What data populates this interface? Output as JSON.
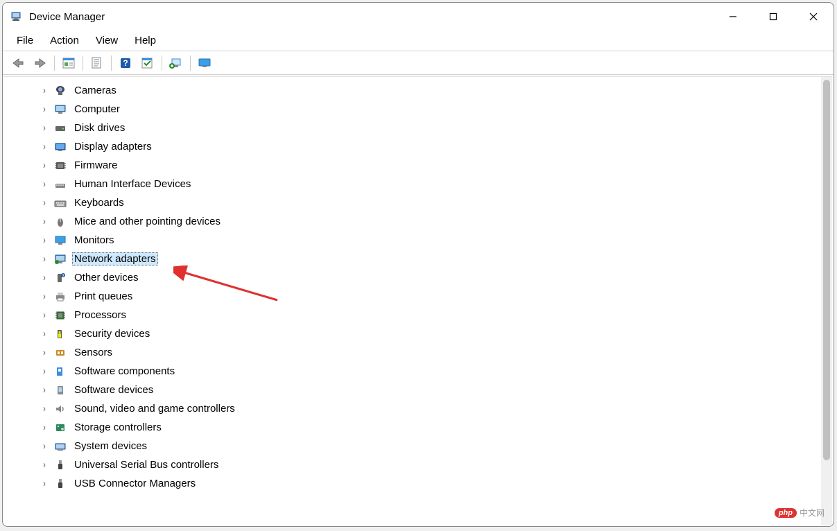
{
  "window": {
    "title": "Device Manager"
  },
  "menu": {
    "file": "File",
    "action": "Action",
    "view": "View",
    "help": "Help"
  },
  "toolbar_icons": {
    "back": "back-arrow",
    "forward": "forward-arrow",
    "show_hide": "show-hide-console-tree",
    "properties": "properties",
    "help": "help",
    "scan": "scan-hardware",
    "add_legacy": "add-legacy-hardware",
    "monitor": "remote-view"
  },
  "tree": {
    "items": [
      {
        "label": "Cameras",
        "icon": "camera-icon"
      },
      {
        "label": "Computer",
        "icon": "computer-icon"
      },
      {
        "label": "Disk drives",
        "icon": "disk-icon"
      },
      {
        "label": "Display adapters",
        "icon": "display-adapter-icon"
      },
      {
        "label": "Firmware",
        "icon": "firmware-icon"
      },
      {
        "label": "Human Interface Devices",
        "icon": "hid-icon"
      },
      {
        "label": "Keyboards",
        "icon": "keyboard-icon"
      },
      {
        "label": "Mice and other pointing devices",
        "icon": "mouse-icon"
      },
      {
        "label": "Monitors",
        "icon": "monitor-icon"
      },
      {
        "label": "Network adapters",
        "icon": "network-adapter-icon",
        "selected": true
      },
      {
        "label": "Other devices",
        "icon": "other-device-icon"
      },
      {
        "label": "Print queues",
        "icon": "printer-icon"
      },
      {
        "label": "Processors",
        "icon": "processor-icon"
      },
      {
        "label": "Security devices",
        "icon": "security-icon"
      },
      {
        "label": "Sensors",
        "icon": "sensor-icon"
      },
      {
        "label": "Software components",
        "icon": "software-component-icon"
      },
      {
        "label": "Software devices",
        "icon": "software-device-icon"
      },
      {
        "label": "Sound, video and game controllers",
        "icon": "sound-icon"
      },
      {
        "label": "Storage controllers",
        "icon": "storage-icon"
      },
      {
        "label": "System devices",
        "icon": "system-device-icon"
      },
      {
        "label": "Universal Serial Bus controllers",
        "icon": "usb-icon"
      },
      {
        "label": "USB Connector Managers",
        "icon": "usb-connector-icon"
      }
    ]
  },
  "watermark": {
    "badge": "php",
    "text": "中文网"
  }
}
